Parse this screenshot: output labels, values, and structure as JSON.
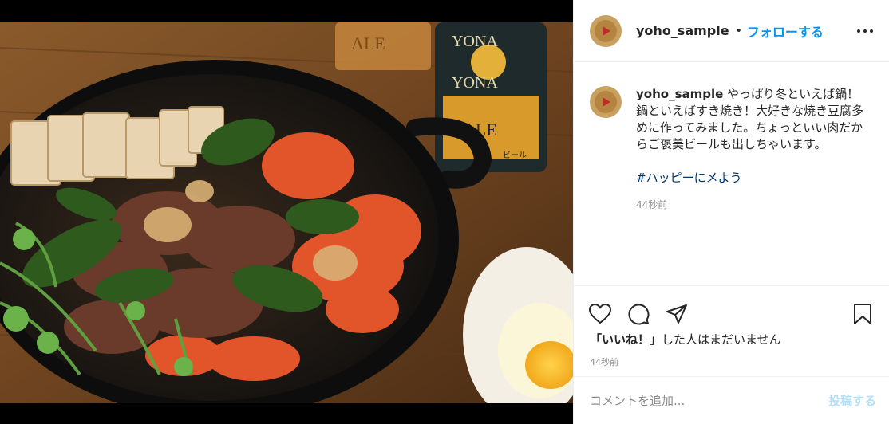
{
  "post": {
    "username": "yoho_sample",
    "separator": "•",
    "follow_label": "フォローする",
    "more_label": "more options"
  },
  "photo": {
    "bottle_text": [
      "YONA",
      "YONA",
      "ALE"
    ],
    "glass_text": "ALE",
    "can_small_text": "ビール",
    "image_subject": "sukiyaki-pot-with-ale-bottle"
  },
  "caption": {
    "username": "yoho_sample",
    "text": "やっぱり冬といえば鍋！鍋といえばすき焼き！大好きな焼き豆腐多めに作ってみました。ちょっといい肉だからご褒美ビールも出しちゃいます。",
    "hashtag": "#ハッピーにメよう",
    "time": "44秒前"
  },
  "actions": {
    "like_icon": "heart-icon",
    "comment_icon": "comment-icon",
    "share_icon": "share-icon",
    "save_icon": "bookmark-icon"
  },
  "likes_text": {
    "bold": "「いいね！」",
    "rest": "した人はまだいません"
  },
  "post_time": "44秒前",
  "comment": {
    "placeholder": "コメントを追加...",
    "post_label": "投稿する"
  },
  "colors": {
    "accent": "#0095f6",
    "hashtag": "#00376b",
    "muted": "#8e8e8e",
    "post_disabled": "#b2dffc"
  }
}
